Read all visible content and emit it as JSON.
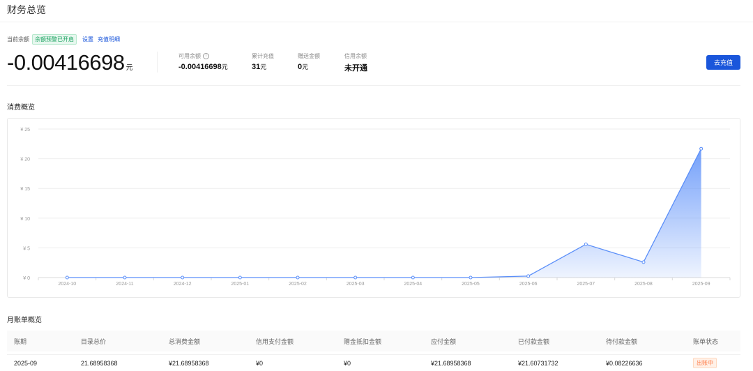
{
  "page": {
    "title": "财务总览"
  },
  "balance": {
    "label": "当前余额",
    "alert_badge": "余额预警已开启",
    "settings_link": "设置",
    "recharge_detail_link": "充值明细",
    "amount": "-0.00416698",
    "unit": "元"
  },
  "stats": [
    {
      "label": "可用余额",
      "value": "-0.00416698",
      "unit": "元",
      "has_info": true
    },
    {
      "label": "累计充值",
      "value": "31",
      "unit": "元"
    },
    {
      "label": "赠送金额",
      "value": "0",
      "unit": "元"
    },
    {
      "label": "信用余额",
      "value": "未开通",
      "unit": ""
    }
  ],
  "recharge_button": "去充值",
  "consumption": {
    "title": "消费概览"
  },
  "chart_data": {
    "type": "area",
    "x": [
      "2024-10",
      "2024-11",
      "2024-12",
      "2025-01",
      "2025-02",
      "2025-03",
      "2025-04",
      "2025-05",
      "2025-06",
      "2025-07",
      "2025-08",
      "2025-09"
    ],
    "values": [
      0,
      0,
      0,
      0,
      0,
      0,
      0,
      0,
      0.25,
      5.6,
      2.6,
      21.69
    ],
    "ylim": [
      0,
      25
    ],
    "yticks": [
      "¥ 0",
      "¥ 5",
      "¥ 10",
      "¥ 15",
      "¥ 20",
      "¥ 25"
    ],
    "ytick_values": [
      0,
      5,
      10,
      15,
      20,
      25
    ],
    "line_color": "#5b8ff9",
    "grid": true
  },
  "monthly": {
    "title": "月账单概览",
    "columns": [
      "账期",
      "目录总价",
      "总消费金额",
      "信用支付金额",
      "赠金抵扣金额",
      "应付金额",
      "已付款金额",
      "待付款金额",
      "账单状态"
    ],
    "rows": [
      [
        "2025-09",
        "21.68958368",
        "¥21.68958368",
        "¥0",
        "¥0",
        "¥21.68958368",
        "¥21.60731732",
        "¥0.08226636",
        "出账中"
      ]
    ]
  }
}
